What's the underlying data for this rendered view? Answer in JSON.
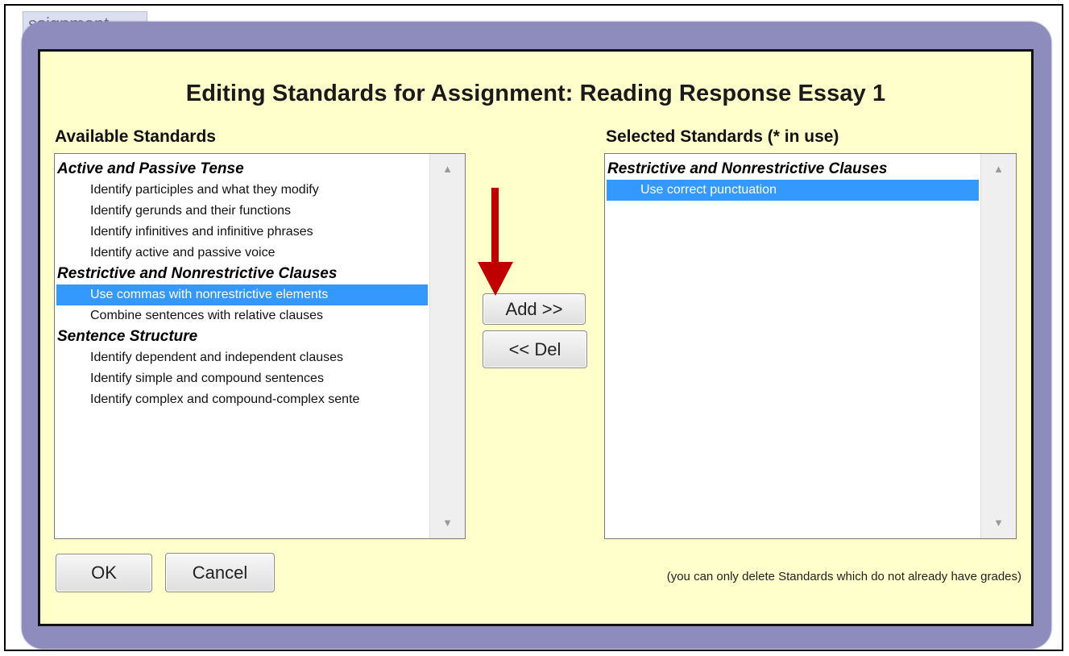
{
  "background": {
    "tab_label": "ssignment"
  },
  "dialog": {
    "title": "Editing Standards for Assignment: Reading Response Essay 1",
    "available": {
      "label": "Available Standards",
      "groups": [
        {
          "label": "Active and Passive Tense",
          "items": [
            {
              "label": "Identify participles and what they modify",
              "selected": false
            },
            {
              "label": "Identify gerunds and their functions",
              "selected": false
            },
            {
              "label": "Identify infinitives and infinitive phrases",
              "selected": false
            },
            {
              "label": "Identify active and passive voice",
              "selected": false
            }
          ]
        },
        {
          "label": "Restrictive and Nonrestrictive Clauses",
          "items": [
            {
              "label": "Use commas with nonrestrictive elements",
              "selected": true
            },
            {
              "label": "Combine sentences with relative clauses",
              "selected": false
            }
          ]
        },
        {
          "label": "Sentence Structure",
          "items": [
            {
              "label": "Identify dependent and independent clauses",
              "selected": false
            },
            {
              "label": "Identify simple and compound sentences",
              "selected": false
            },
            {
              "label": "Identify complex and compound-complex sente",
              "selected": false
            }
          ]
        }
      ]
    },
    "selected": {
      "label": "Selected Standards (* in use)",
      "groups": [
        {
          "label": "Restrictive and Nonrestrictive Clauses",
          "items": [
            {
              "label": "Use correct punctuation",
              "selected": true
            }
          ]
        }
      ]
    },
    "buttons": {
      "add": "Add >>",
      "del": "<< Del",
      "ok": "OK",
      "cancel": "Cancel"
    },
    "footnote": "(you can only delete Standards which do not already have grades)"
  },
  "colors": {
    "modal_background": "#ffffcc",
    "modal_border": "#8e8bbd",
    "selection": "#3399ff",
    "annotation_arrow": "#c00000"
  }
}
